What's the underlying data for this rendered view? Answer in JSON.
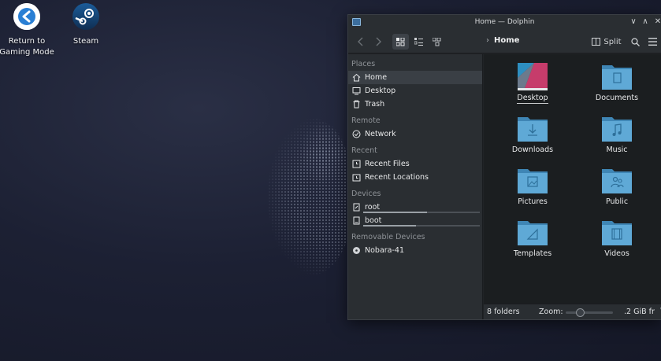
{
  "desktop": {
    "icons": [
      {
        "label_line1": "Return to",
        "label_line2": "Gaming Mode",
        "icon": "return-arrow-icon"
      },
      {
        "label_line1": "Steam",
        "label_line2": "",
        "icon": "steam-icon"
      }
    ]
  },
  "window": {
    "title": "Home — Dolphin",
    "breadcrumb": "Home",
    "split_label": "Split",
    "controls": {
      "minimize": "∨",
      "maximize": "∧",
      "close": "✕"
    }
  },
  "sidebar": {
    "sections": [
      {
        "title": "Places",
        "items": [
          {
            "label": "Home",
            "icon": "home-icon",
            "selected": true
          },
          {
            "label": "Desktop",
            "icon": "desktop-icon"
          },
          {
            "label": "Trash",
            "icon": "trash-icon"
          }
        ]
      },
      {
        "title": "Remote",
        "items": [
          {
            "label": "Network",
            "icon": "network-icon"
          }
        ]
      },
      {
        "title": "Recent",
        "items": [
          {
            "label": "Recent Files",
            "icon": "recent-files-icon"
          },
          {
            "label": "Recent Locations",
            "icon": "recent-locations-icon"
          }
        ]
      },
      {
        "title": "Devices",
        "items": [
          {
            "label": "root",
            "icon": "drive-icon",
            "usage": 0.55
          },
          {
            "label": "boot",
            "icon": "drive-icon",
            "usage": 0.45
          }
        ]
      },
      {
        "title": "Removable Devices",
        "items": [
          {
            "label": "Nobara-41",
            "icon": "optical-disc-icon"
          }
        ]
      }
    ]
  },
  "folders": [
    {
      "label": "Desktop",
      "icon": "desktop-folder-icon"
    },
    {
      "label": "Documents",
      "icon": "documents-folder-icon"
    },
    {
      "label": "Downloads",
      "icon": "downloads-folder-icon"
    },
    {
      "label": "Music",
      "icon": "music-folder-icon"
    },
    {
      "label": "Pictures",
      "icon": "pictures-folder-icon"
    },
    {
      "label": "Public",
      "icon": "public-folder-icon"
    },
    {
      "label": "Templates",
      "icon": "templates-folder-icon"
    },
    {
      "label": "Videos",
      "icon": "videos-folder-icon"
    }
  ],
  "statusbar": {
    "status": "8 folders",
    "zoom_label": "Zoom:",
    "zoom_level": 0.3,
    "free_space": ".2 GiB fr"
  },
  "colors": {
    "folder": "#5fa9d6",
    "folder_dark": "#3f86b5",
    "accent": "#3daee9"
  }
}
